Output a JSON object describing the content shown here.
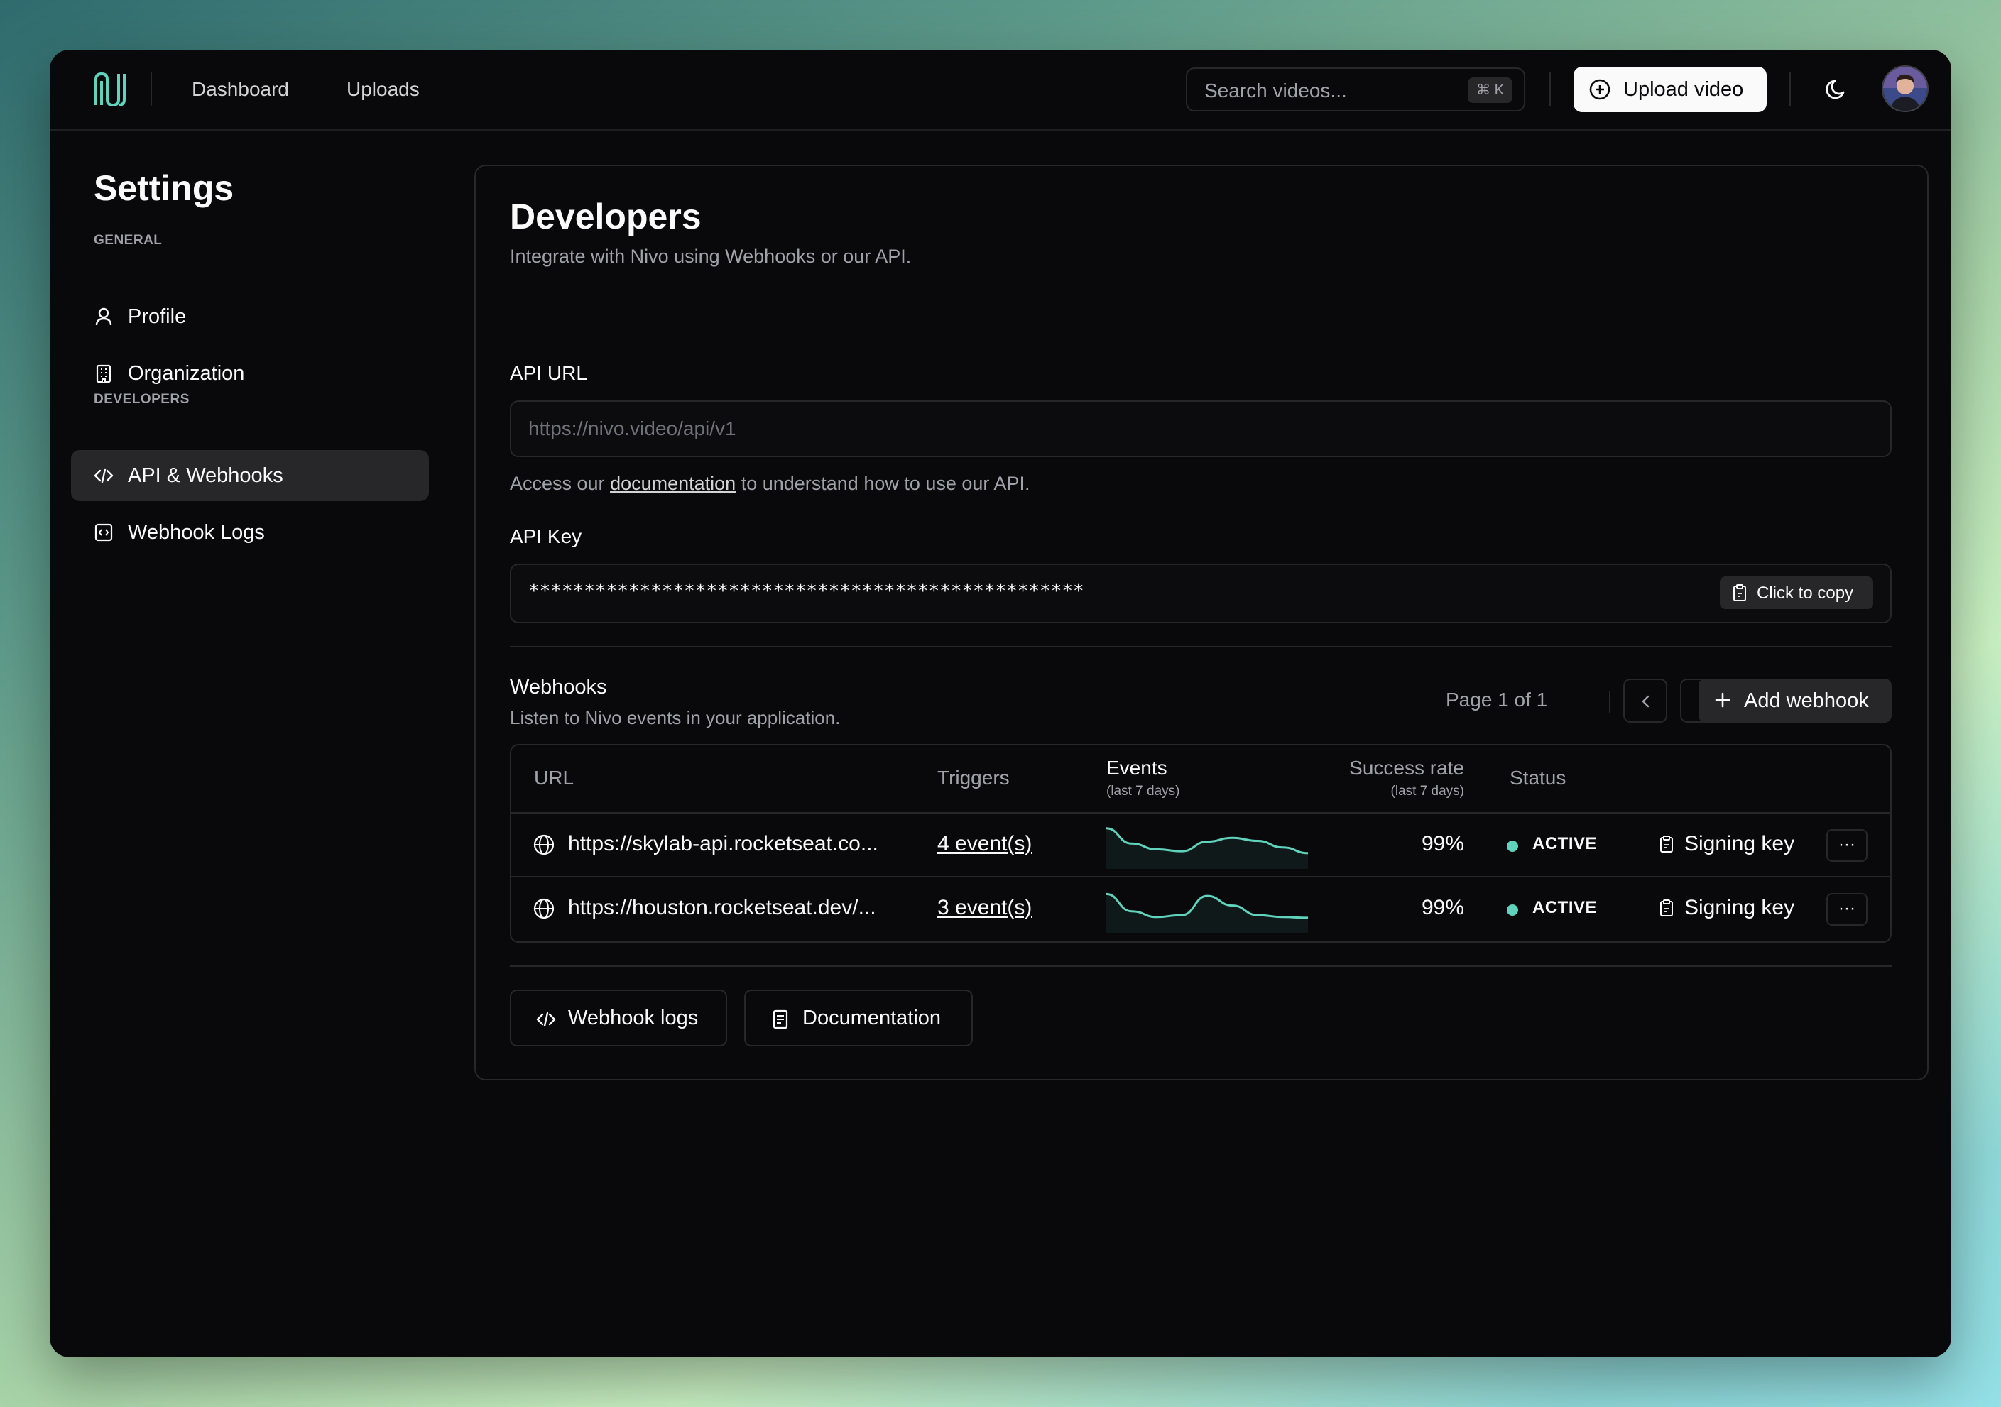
{
  "header": {
    "nav": [
      "Dashboard",
      "Uploads"
    ],
    "search_placeholder": "Search videos...",
    "search_shortcut": "⌘ K",
    "upload_label": "Upload video"
  },
  "sidebar": {
    "title": "Settings",
    "sections": [
      {
        "label": "GENERAL",
        "items": [
          {
            "label": "Profile",
            "icon": "user-icon"
          },
          {
            "label": "Organization",
            "icon": "building-icon"
          }
        ]
      },
      {
        "label": "DEVELOPERS",
        "items": [
          {
            "label": "API & Webhooks",
            "icon": "code-icon",
            "active": true
          },
          {
            "label": "Webhook Logs",
            "icon": "logs-icon"
          }
        ]
      }
    ]
  },
  "main": {
    "title": "Developers",
    "subtitle": "Integrate with Nivo using Webhooks or our API.",
    "api_url": {
      "label": "API URL",
      "value": "https://nivo.video/api/v1",
      "help_prefix": "Access our ",
      "help_link": "documentation",
      "help_suffix": " to understand how to use our API."
    },
    "api_key": {
      "label": "API Key",
      "value": "**************************************************",
      "copy_label": "Click to copy"
    },
    "webhooks": {
      "title": "Webhooks",
      "subtitle": "Listen to Nivo events in your application.",
      "page_info": "Page 1 of 1",
      "add_label": "Add webhook",
      "columns": {
        "url": "URL",
        "triggers": "Triggers",
        "events": "Events",
        "events_sub": "(last 7 days)",
        "rate": "Success rate",
        "rate_sub": "(last 7 days)",
        "status": "Status"
      },
      "rows": [
        {
          "url": "https://skylab-api.rocketseat.co...",
          "triggers": "4 event(s)",
          "rate": "99%",
          "status": "ACTIVE",
          "signing": "Signing key",
          "more": "···",
          "trend": [
            0.95,
            0.55,
            0.4,
            0.35,
            0.6,
            0.7,
            0.62,
            0.45,
            0.3
          ]
        },
        {
          "url": "https://houston.rocketseat.dev/...",
          "triggers": "3 event(s)",
          "rate": "99%",
          "status": "ACTIVE",
          "signing": "Signing key",
          "more": "···",
          "trend": [
            0.9,
            0.45,
            0.3,
            0.35,
            0.85,
            0.6,
            0.35,
            0.3,
            0.28
          ]
        }
      ]
    },
    "footer": {
      "logs_label": "Webhook logs",
      "docs_label": "Documentation"
    }
  },
  "colors": {
    "accent": "#5fd3bc",
    "background": "#09090b",
    "border": "#27272a"
  }
}
